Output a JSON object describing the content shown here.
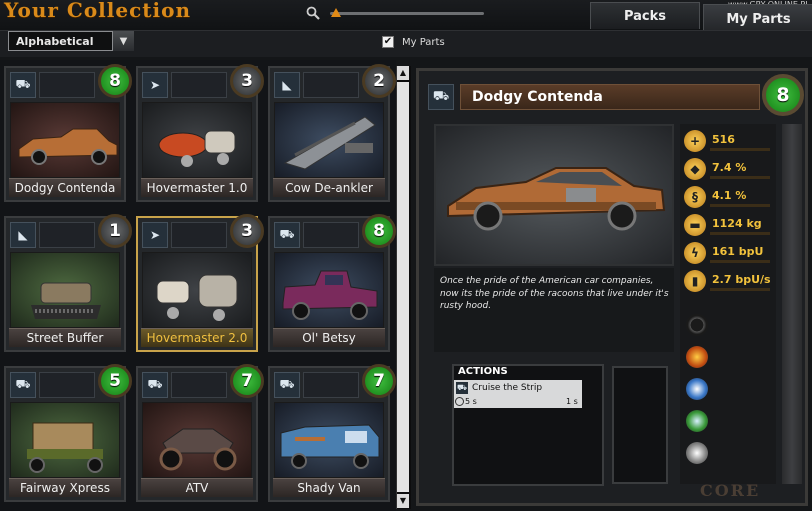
{
  "header": {
    "title": "Your Collection",
    "watermark": "www.GRY-ONLINE.PL"
  },
  "zoom": {
    "level": 0.02
  },
  "tabs": [
    {
      "label": "Packs"
    },
    {
      "label": "My Parts",
      "active": true
    }
  ],
  "filters": {
    "sort": "Alphabetical",
    "my_parts_label": "My Parts",
    "my_parts_checked": true
  },
  "cards": [
    {
      "name": "Dodgy Contenda",
      "level": "8",
      "badge_color": "green",
      "slot_icon": "cab-icon",
      "selected": false
    },
    {
      "name": "Hovermaster 1.0",
      "level": "3",
      "badge_color": "grey",
      "slot_icon": "fish-icon",
      "selected": false
    },
    {
      "name": "Cow De-ankler",
      "level": "2",
      "badge_color": "grey",
      "slot_icon": "wedge-icon",
      "selected": false
    },
    {
      "name": "Street Buffer",
      "level": "1",
      "badge_color": "grey",
      "slot_icon": "wedge-icon",
      "selected": false
    },
    {
      "name": "Hovermaster 2.0",
      "level": "3",
      "badge_color": "grey",
      "slot_icon": "fish-icon",
      "selected": true
    },
    {
      "name": "Ol' Betsy",
      "level": "8",
      "badge_color": "green",
      "slot_icon": "cab-icon",
      "selected": false
    },
    {
      "name": "Fairway Xpress",
      "level": "5",
      "badge_color": "green",
      "slot_icon": "cab-icon",
      "selected": false
    },
    {
      "name": "ATV",
      "level": "7",
      "badge_color": "green",
      "slot_icon": "cab-icon",
      "selected": false
    },
    {
      "name": "Shady Van",
      "level": "7",
      "badge_color": "green",
      "slot_icon": "cab-icon",
      "selected": false
    }
  ],
  "detail": {
    "name": "Dodgy Contenda",
    "level": "8",
    "description": "Once the pride of the American car companies, now its the pride of the racoons that live under it's rusty hood.",
    "stats": [
      {
        "icon": "plus-icon",
        "value": "516"
      },
      {
        "icon": "shield-icon",
        "value": "7.4 %"
      },
      {
        "icon": "spring-icon",
        "value": "4.1 %"
      },
      {
        "icon": "weight-icon",
        "value": "1124 kg"
      },
      {
        "icon": "lightning-icon",
        "value": "161 bpU"
      },
      {
        "icon": "battery-icon",
        "value": "2.7 bpU/s"
      }
    ],
    "abilities": [
      "explosion-icon",
      "fire-icon",
      "wave-icon",
      "bolt-icon",
      "claw-icon"
    ],
    "actions": {
      "title": "ACTIONS",
      "items": [
        {
          "name": "Cruise the Strip",
          "time": "5 s",
          "cooldown": "1 s"
        }
      ]
    },
    "core_label": "CORE"
  },
  "colors": {
    "accent": "#d98a1a",
    "badge_green": "#1f9a1f",
    "stat_text": "#f2c23c",
    "selected_border": "#c8a34a"
  }
}
